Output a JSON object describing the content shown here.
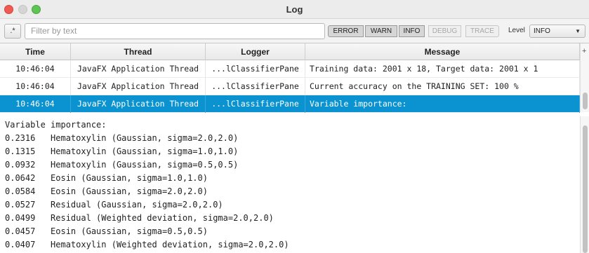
{
  "window": {
    "title": "Log"
  },
  "toolbar": {
    "regex_label": ".*",
    "filter_placeholder": "Filter by text",
    "levels": {
      "error": "ERROR",
      "warn": "WARN",
      "info": "INFO",
      "debug": "DEBUG",
      "trace": "TRACE"
    },
    "level_label": "Level",
    "level_value": "INFO"
  },
  "table": {
    "headers": {
      "time": "Time",
      "thread": "Thread",
      "logger": "Logger",
      "message": "Message"
    },
    "rows": [
      {
        "time": "10:46:04",
        "thread": "JavaFX Application Thread",
        "logger": "...lClassifierPane",
        "message": "Training data: 2001 x 18, Target data: 2001 x 1",
        "selected": false
      },
      {
        "time": "10:46:04",
        "thread": "JavaFX Application Thread",
        "logger": "...lClassifierPane",
        "message": "Current accuracy on the TRAINING SET: 100 %",
        "selected": false
      },
      {
        "time": "10:46:04",
        "thread": "JavaFX Application Thread",
        "logger": "...lClassifierPane",
        "message": "Variable importance:",
        "selected": true
      }
    ]
  },
  "details": {
    "lines": [
      "Variable importance:",
      "0.2316   Hematoxylin (Gaussian, sigma=2.0,2.0)",
      "0.1315   Hematoxylin (Gaussian, sigma=1.0,1.0)",
      "0.0932   Hematoxylin (Gaussian, sigma=0.5,0.5)",
      "0.0642   Eosin (Gaussian, sigma=1.0,1.0)",
      "0.0584   Eosin (Gaussian, sigma=2.0,2.0)",
      "0.0527   Residual (Gaussian, sigma=2.0,2.0)",
      "0.0499   Residual (Weighted deviation, sigma=2.0,2.0)",
      "0.0457   Eosin (Gaussian, sigma=0.5,0.5)",
      "0.0407   Hematoxylin (Weighted deviation, sigma=2.0,2.0)"
    ]
  },
  "colors": {
    "selection": "#0b93d1",
    "close": "#ee5a52",
    "maximize": "#5fc454"
  }
}
